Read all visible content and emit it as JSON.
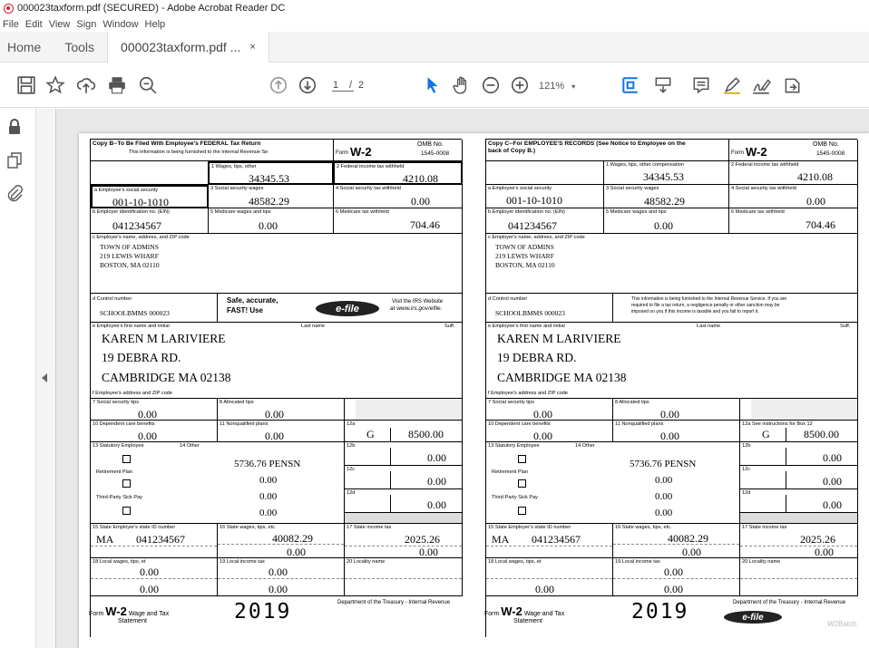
{
  "window": {
    "title": "000023taxform.pdf (SECURED) - Adobe Acrobat Reader DC"
  },
  "menu": [
    "File",
    "Edit",
    "View",
    "Sign",
    "Window",
    "Help"
  ],
  "tabs": {
    "home": "Home",
    "tools": "Tools",
    "doc": "000023taxform.pdf ...",
    "close": "×"
  },
  "toolbar": {
    "page_current": "1",
    "page_sep": "/",
    "page_total": "2",
    "zoom": "121%"
  },
  "icons": [
    "save-icon",
    "bookmark-star-icon",
    "upload-icon",
    "print-icon",
    "zoom-out-icon",
    "page-up-icon",
    "page-down-icon",
    "select-arrow-icon",
    "hand-icon",
    "zoom-minus-icon",
    "zoom-plus-icon",
    "fit-page-icon",
    "scroll-mode-icon",
    "comment-icon",
    "highlight-pen-icon",
    "sign-icon",
    "share-icon",
    "lock-icon",
    "copy-pages-icon",
    "attachment-icon"
  ],
  "copyB": {
    "header": "Copy B--To Be Filed With Employee's FEDERAL Tax Return",
    "header2": "This information is being furnished to the Internal Revenue Se",
    "form": "Form",
    "w2": "W-2",
    "omb": "OMB No.",
    "omb_num": "1545-0008",
    "l1": "1  Wages, tips, other",
    "v1": "34345.53",
    "l2": "2  Federal income tax withheld",
    "v2": "4210.08",
    "la": "a Employee's social security",
    "va": "001-10-1010",
    "l3": "3  Social security wages",
    "v3": "48582.29",
    "l4": "4  Social security tax withheld",
    "v4": "0.00",
    "lb": "b  Employer identification no. (EIN)",
    "vb": "041234567",
    "l5": "5  Medicare wages and tips",
    "v5": "0.00",
    "l6": "6  Medicare tax withheld",
    "v6": "704.46",
    "lc": "c  Employer's name, address, and ZIP code",
    "emp1": "TOWN OF ADMINS",
    "emp2": "219 LEWIS WHARF",
    "emp3": "BOSTON, MA 02110",
    "ld": "d  Control number",
    "vd": "SCHOOLBMMS 000023",
    "safe1": "Safe, accurate,",
    "safe2": "FAST! Use",
    "efile": "e-file",
    "visit1": "Visit the IRS Website",
    "visit2": "at www.irs.gov/efile.",
    "le": "e  Employee's first name and initial",
    "last": "Last name",
    "suff": "Suff.",
    "n1": "KAREN M LARIVIERE",
    "n2": "19 DEBRA RD.",
    "n3": "CAMBRIDGE MA 02138",
    "lf": "f  Employee's address and ZIP code",
    "l7": "7  Social security tips",
    "v7": "0.00",
    "l8": "8  Allocated tips",
    "v8": "0.00",
    "l9": "9",
    "l10": "10  Dependent care benefits",
    "v10": "0.00",
    "l11": "11  Nonqualified plans",
    "v11": "0.00",
    "l12a": "12a",
    "c12a": "G",
    "v12a": "8500.00",
    "l13": "13  Statutory Employee",
    "l14": "14  Other",
    "ret": "Retirement Plan",
    "tps": "Third-Party Sick Pay",
    "o1": "5736.76  PENSN",
    "o2": "0.00",
    "o3": "0.00",
    "o4": "0.00",
    "l12b": "12b",
    "v12b": "0.00",
    "l12c": "12c",
    "v12c": "0.00",
    "l12d": "12d",
    "v12d": "0.00",
    "l15": "15 State     Employer's state ID number",
    "st": "MA",
    "sid": "041234567",
    "l16": "16  State wages, tips, etc.",
    "v16": "40082.29",
    "v16b": "0.00",
    "l17": "17  State income tax",
    "v17": "2025.26",
    "v17b": "0.00",
    "l18": "18  Local wages, tips, et",
    "v18": "0.00",
    "v18b": "0.00",
    "l19": "19  Local income tax",
    "v19": "0.00",
    "v19b": "0.00",
    "l20": "20  Locality name",
    "ft1": "Wage and Tax",
    "ft2": "Statement",
    "year": "2019",
    "dept": "Department of the Treasury - Internal Revenue"
  },
  "copyC": {
    "header": "Copy C--For EMPLOYEE'S RECORDS (See Notice to Employee on the",
    "header2": "back of Copy B.)",
    "l1": "1  Wages, tips, other compensation",
    "l12a": "12a See instructions for Box 12",
    "notice1": "This information is being furnished to the Internal Revenue Service. If you are",
    "notice2": "required to file a tax return, a negligence penalty or other sanction may be",
    "notice3": "imposed on you if this income is taxable and you fail to report it.",
    "la": "a  Employee's social security",
    "l3": "3  Social security wages",
    "l2": "2  Federal income tax withheld",
    "batch": "W2Batch"
  }
}
